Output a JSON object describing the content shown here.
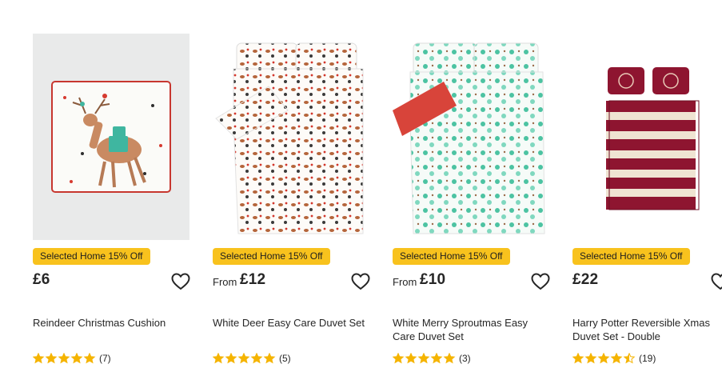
{
  "products": [
    {
      "badge": "Selected Home 15% Off",
      "price_prefix": "",
      "price": "£6",
      "title": "Reindeer Christmas Cushion",
      "rating": 5,
      "review_count": "(7)"
    },
    {
      "badge": "Selected Home 15% Off",
      "price_prefix": "From",
      "price": "£12",
      "title": "White Deer Easy Care Duvet Set",
      "rating": 5,
      "review_count": "(5)"
    },
    {
      "badge": "Selected Home 15% Off",
      "price_prefix": "From",
      "price": "£10",
      "title": "White Merry Sproutmas Easy Care Duvet Set",
      "rating": 5,
      "review_count": "(3)"
    },
    {
      "badge": "Selected Home 15% Off",
      "price_prefix": "",
      "price": "£22",
      "title": "Harry Potter Reversible Xmas Duvet Set - Double",
      "rating": 4.5,
      "review_count": "(19)"
    }
  ],
  "colors": {
    "badge": "#f8c21d",
    "star": "#f5b400",
    "text": "#262626"
  },
  "icons": {
    "wishlist": "heart-outline-icon",
    "rating": "star-icon"
  }
}
